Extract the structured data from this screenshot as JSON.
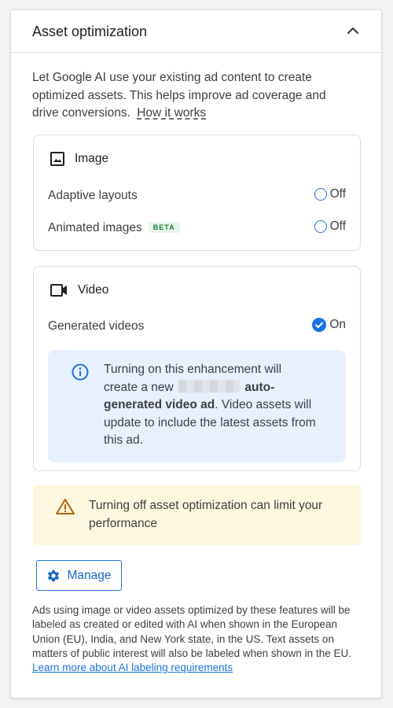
{
  "header": {
    "title": "Asset optimization",
    "collapse_icon": "chevron-up-icon"
  },
  "intro": {
    "text": "Let Google AI use your existing ad content to create optimized assets. This helps improve ad coverage and drive conversions.",
    "link": "How it works"
  },
  "image_card": {
    "title": "Image",
    "icon": "image-icon",
    "rows": [
      {
        "label": "Adaptive layouts",
        "state": "Off"
      },
      {
        "label": "Animated images",
        "badge": "BETA",
        "state": "Off"
      }
    ]
  },
  "video_card": {
    "title": "Video",
    "icon": "videocam-icon",
    "row": {
      "label": "Generated videos",
      "state": "On"
    },
    "info": {
      "icon": "info-icon",
      "text_a": "Turning on this enhancement will create a new",
      "bold_a": "auto-generated video ad",
      "text_b": ". Video assets will update to include the latest assets from this ad."
    }
  },
  "warning": {
    "icon": "warning-icon",
    "text": "Turning off asset optimization can limit your performance"
  },
  "manage_button": {
    "label": "Manage",
    "icon": "gear-icon"
  },
  "footer": {
    "text": "Ads using image or video assets optimized by these features will be labeled as created or edited with AI when shown in the European Union (EU), India, and New York state, in the US. Text assets on matters of public interest will also be labeled when shown in the EU.",
    "link": "Learn more about AI labeling requirements"
  },
  "colors": {
    "accent": "#1a73e8",
    "info_bg": "#e8f0fe",
    "warning_bg": "#fef7e0",
    "warning_icon": "#b06000",
    "beta_text": "#188038"
  }
}
